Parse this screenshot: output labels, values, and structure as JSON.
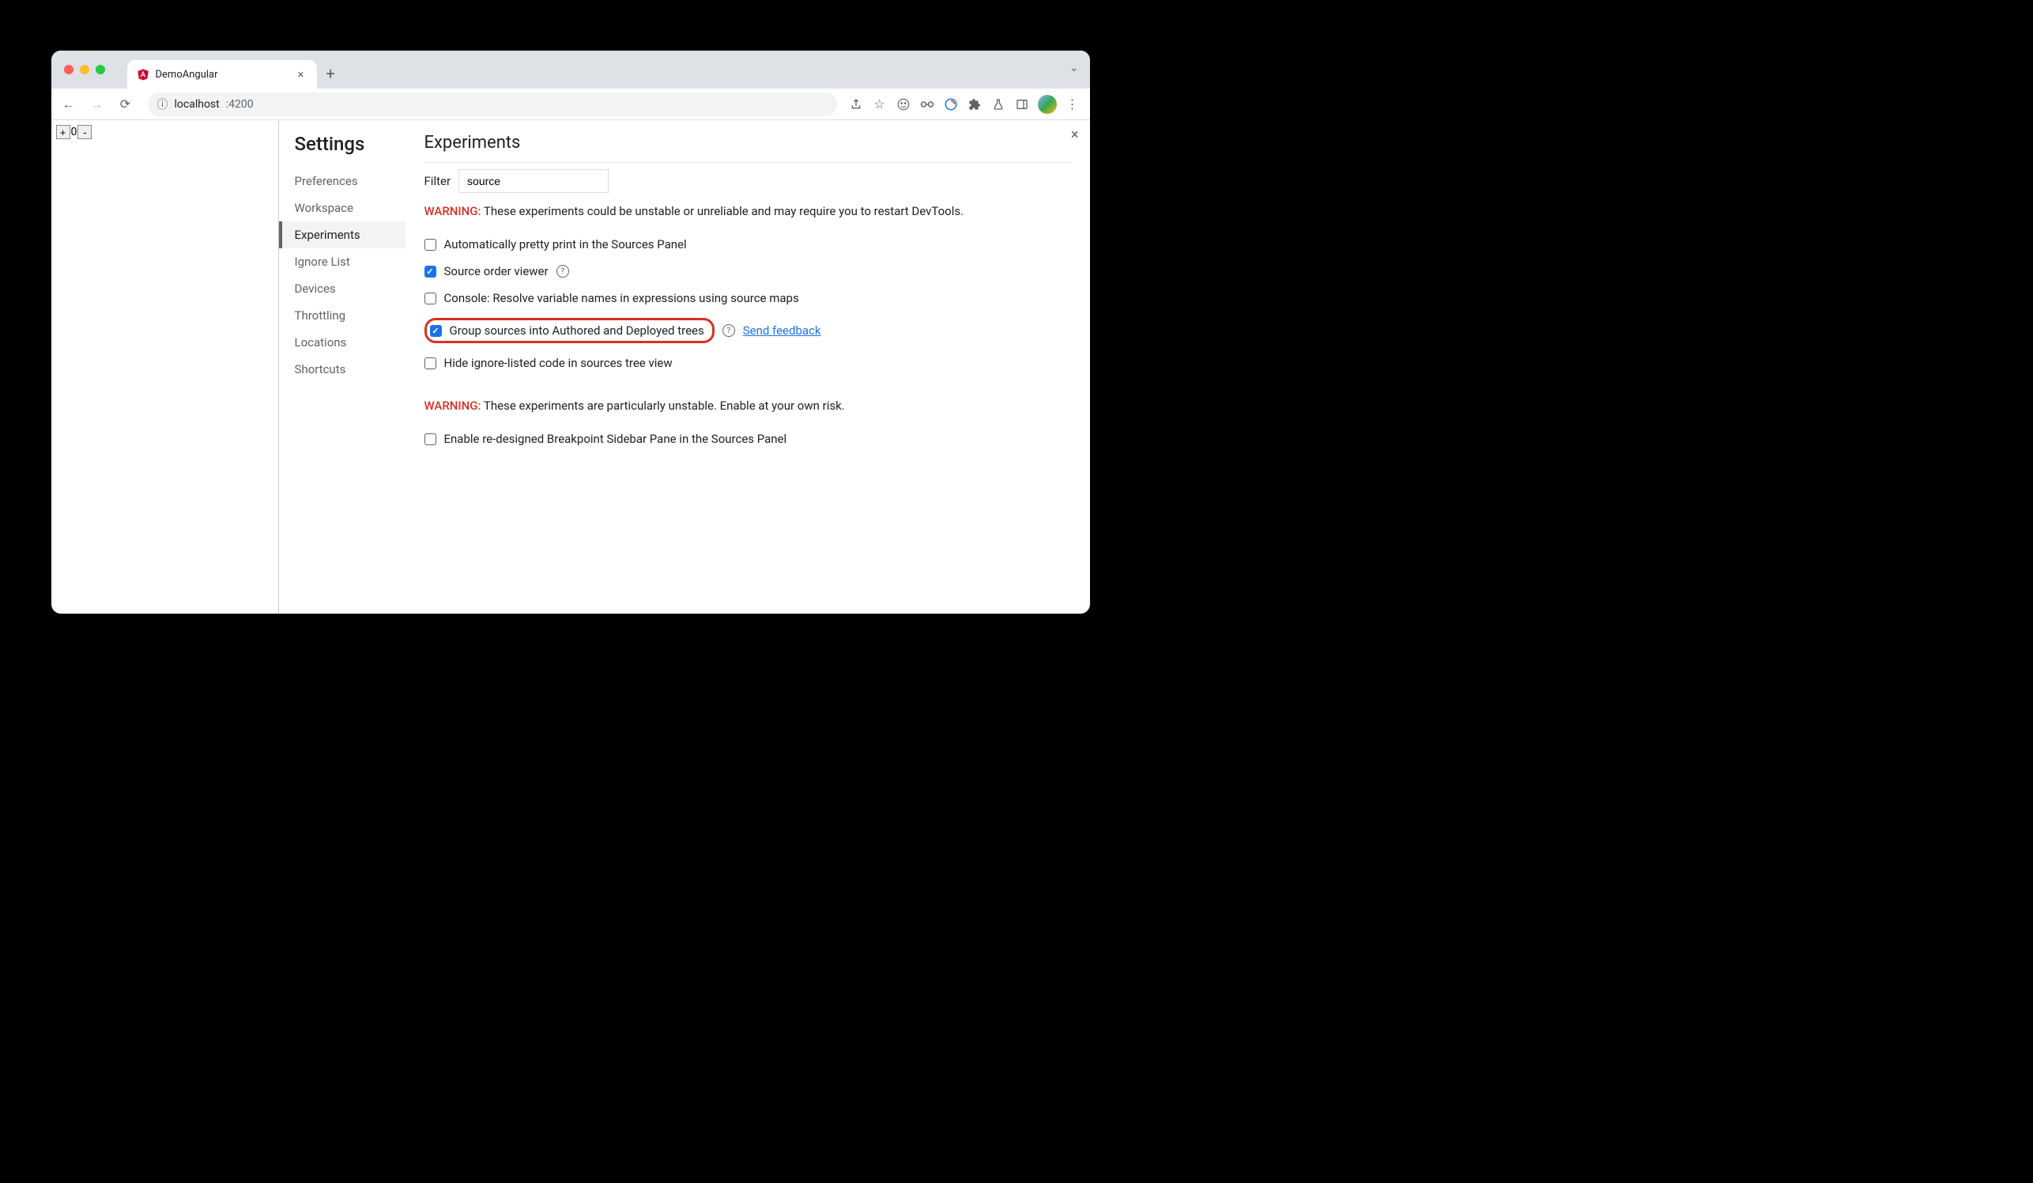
{
  "browser": {
    "tab_title": "DemoAngular",
    "url_host": "localhost",
    "url_port": ":4200"
  },
  "counter": {
    "plus": "+",
    "value": "0",
    "minus": "-"
  },
  "settings": {
    "title": "Settings",
    "nav": {
      "preferences": "Preferences",
      "workspace": "Workspace",
      "experiments": "Experiments",
      "ignore_list": "Ignore List",
      "devices": "Devices",
      "throttling": "Throttling",
      "locations": "Locations",
      "shortcuts": "Shortcuts"
    }
  },
  "experiments": {
    "title": "Experiments",
    "filter_label": "Filter",
    "filter_value": "source",
    "warning1_prefix": "WARNING:",
    "warning1_text": " These experiments could be unstable or unreliable and may require you to restart DevTools.",
    "items": {
      "pretty_print": "Automatically pretty print in the Sources Panel",
      "source_order": "Source order viewer",
      "console_resolve": "Console: Resolve variable names in expressions using source maps",
      "group_sources": "Group sources into Authored and Deployed trees",
      "hide_ignore": "Hide ignore-listed code in sources tree view",
      "breakpoint_pane": "Enable re-designed Breakpoint Sidebar Pane in the Sources Panel"
    },
    "feedback_link": "Send feedback",
    "warning2_prefix": "WARNING:",
    "warning2_text": " These experiments are particularly unstable. Enable at your own risk."
  }
}
